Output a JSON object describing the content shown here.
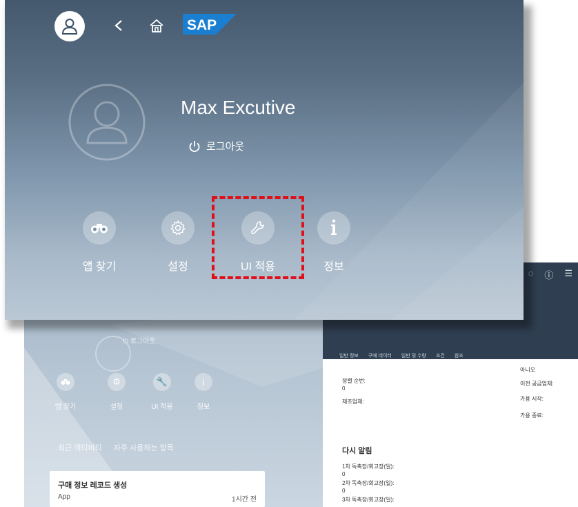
{
  "header": {
    "logo_text": "SAP"
  },
  "user": {
    "name": "Max Excutive",
    "logout_label": "로그아웃"
  },
  "actions": [
    {
      "label": "앱 찾기",
      "icon": "binoculars-icon"
    },
    {
      "label": "설정",
      "icon": "gear-icon"
    },
    {
      "label": "UI 적용",
      "icon": "wrench-icon"
    },
    {
      "label": "정보",
      "icon": "info-icon"
    }
  ],
  "highlight_color": "#e0101a",
  "background_page": {
    "logout_label": "로그아웃",
    "actions": [
      "앱 찾기",
      "설정",
      "UI 적용",
      "정보"
    ],
    "tabs": [
      "최근 액티비티",
      "자주 사용하는 항목"
    ],
    "card": {
      "title": "구매 정보 레코드 생성",
      "type": "App",
      "time": "1시간 전"
    }
  },
  "right_panel": {
    "tabs": [
      "일반 정보",
      "구매 데이터",
      "일반 및 수량",
      "조건",
      "참조"
    ],
    "fields_left": [
      {
        "label": "정렬 순번:",
        "value": "0"
      },
      {
        "label": "제조업체:",
        "value": ""
      }
    ],
    "fields_right": [
      {
        "label": "",
        "value": "아니오"
      },
      {
        "label": "이전 공급업체:",
        "value": ""
      },
      {
        "label": "가용 시작:",
        "value": ""
      },
      {
        "label": "가용 종료:",
        "value": ""
      }
    ],
    "section_title": "다시 알림",
    "reminders": [
      {
        "label": "1차 독촉장/회고장(일):",
        "value": "0"
      },
      {
        "label": "2차 독촉장/회고장(일):",
        "value": "0"
      },
      {
        "label": "3차 독촉장/회고장(일):",
        "value": ""
      }
    ]
  }
}
